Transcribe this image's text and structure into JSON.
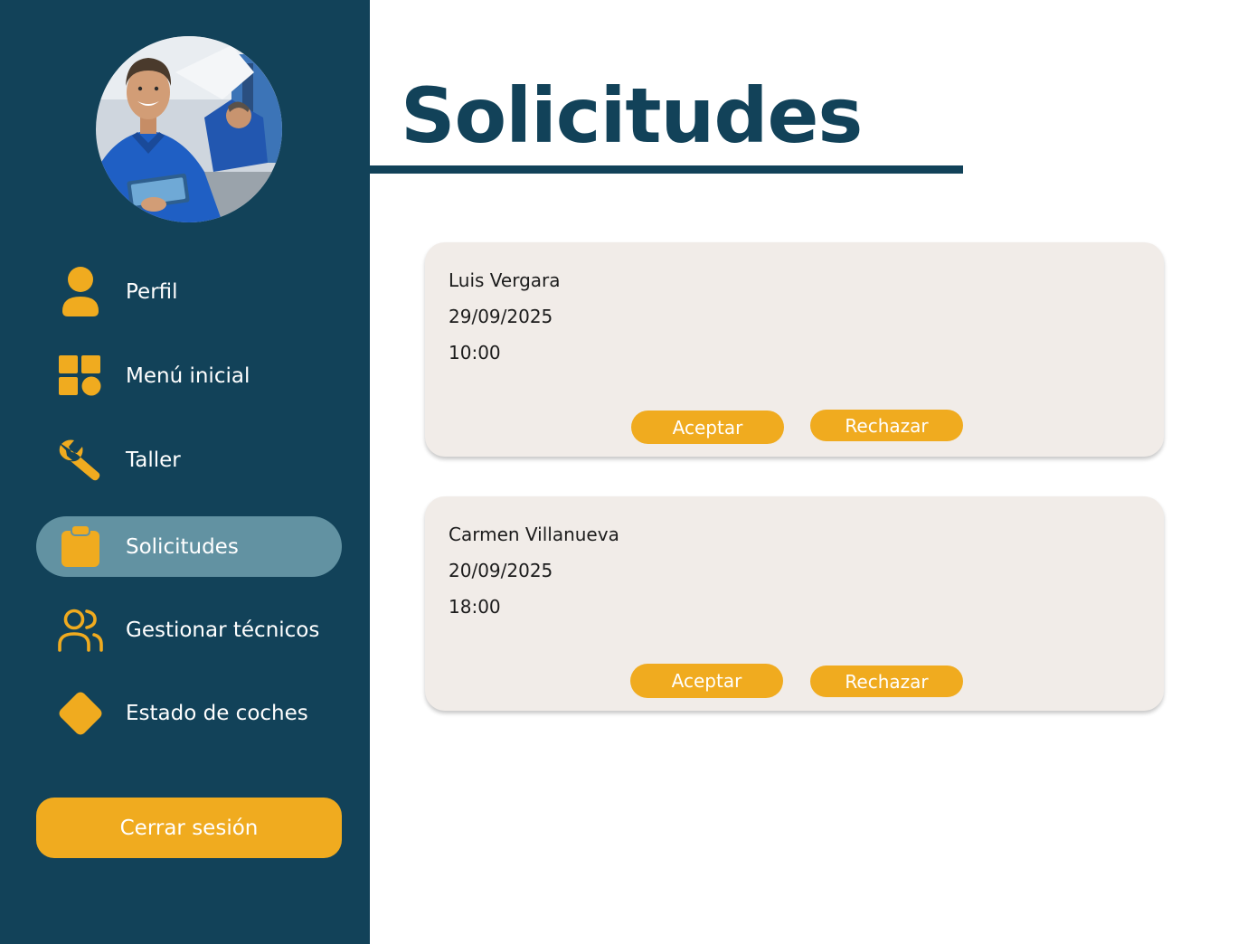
{
  "page": {
    "title": "Solicitudes"
  },
  "sidebar": {
    "items": [
      {
        "label": "Perfil",
        "icon": "user-icon"
      },
      {
        "label": "Menú inicial",
        "icon": "grid-icon"
      },
      {
        "label": "Taller",
        "icon": "wrench-icon"
      },
      {
        "label": "Solicitudes",
        "icon": "clipboard-icon",
        "active": true
      },
      {
        "label": "Gestionar técnicos",
        "icon": "users-icon"
      },
      {
        "label": "Estado de coches",
        "icon": "diamond-icon"
      }
    ],
    "logout_label": "Cerrar sesión"
  },
  "requests": [
    {
      "name": "Luis Vergara",
      "date": "29/09/2025",
      "time": "10:00",
      "accept_label": "Aceptar",
      "reject_label": "Rechazar"
    },
    {
      "name": "Carmen Villanueva",
      "date": "20/09/2025",
      "time": "18:00",
      "accept_label": "Aceptar",
      "reject_label": "Rechazar"
    }
  ],
  "colors": {
    "sidebar_bg": "#124259",
    "accent": "#f0ab1f",
    "active_item_bg": "#6292a2",
    "card_bg": "#f1ece8",
    "title": "#124259"
  }
}
